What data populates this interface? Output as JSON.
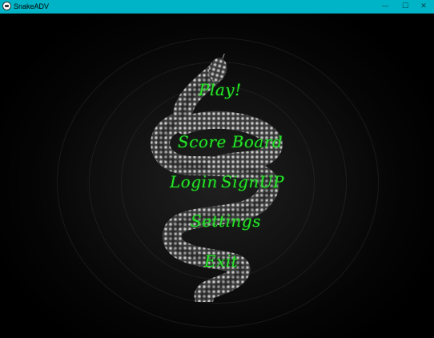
{
  "window": {
    "title": "SnakeADV",
    "minimize_label": "—",
    "maximize_label": "☐",
    "close_label": "✕"
  },
  "menu": {
    "play": "Play!",
    "score_board": "Score Board",
    "login": "Login",
    "signup": "SignUP",
    "settings": "Settings",
    "exit": "Exit"
  },
  "colors": {
    "titlebar": "#00b4c7",
    "menu_text": "#27e62a",
    "background": "#000000"
  },
  "icons": [
    "app-icon",
    "snake-image"
  ]
}
